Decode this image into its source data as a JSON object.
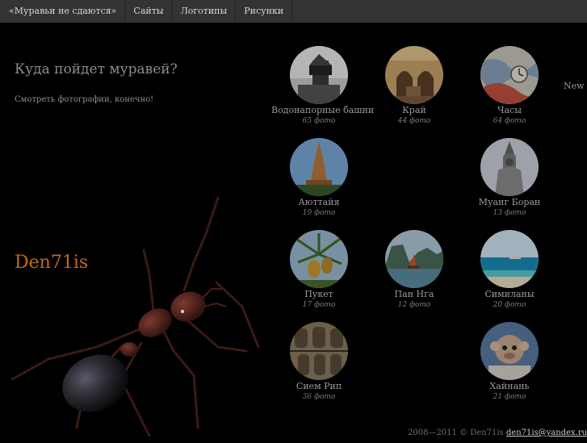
{
  "nav": {
    "items": [
      {
        "label": "«Муравьи не сдаются»"
      },
      {
        "label": "Сайты"
      },
      {
        "label": "Логотипы"
      },
      {
        "label": "Рисунки"
      }
    ]
  },
  "intro": {
    "headline": "Куда пойдет муравей?",
    "subline": "Смотреть фотографии, конечно!"
  },
  "brand": "Den71is",
  "new_label": "New",
  "galleries": [
    {
      "title": "Водонапорные башни",
      "count": "65 фото",
      "icon": "water-tower-photo"
    },
    {
      "title": "Край",
      "count": "44 фото",
      "icon": "arch-building-photo"
    },
    {
      "title": "Часы",
      "count": "64 фото",
      "icon": "map-clock-photo"
    },
    {
      "title": "Аюттайя",
      "count": "19 фото",
      "icon": "temple-photo"
    },
    {
      "title": "Муанг Боран",
      "count": "13 фото",
      "icon": "statue-photo"
    },
    {
      "title": "Пукет",
      "count": "17 фото",
      "icon": "pineapple-palm-photo"
    },
    {
      "title": "Пан Нга",
      "count": "12 фото",
      "icon": "bay-boat-photo"
    },
    {
      "title": "Симиланы",
      "count": "20 фото",
      "icon": "sea-beach-photo"
    },
    {
      "title": "Сием Рип",
      "count": "36 фото",
      "icon": "stone-relief-photo"
    },
    {
      "title": "Хайнань",
      "count": "21 фото",
      "icon": "monkey-photo"
    }
  ],
  "footer": {
    "copyright": "2008—2011 © Den71is",
    "email": "den71is@yandex.ru"
  }
}
